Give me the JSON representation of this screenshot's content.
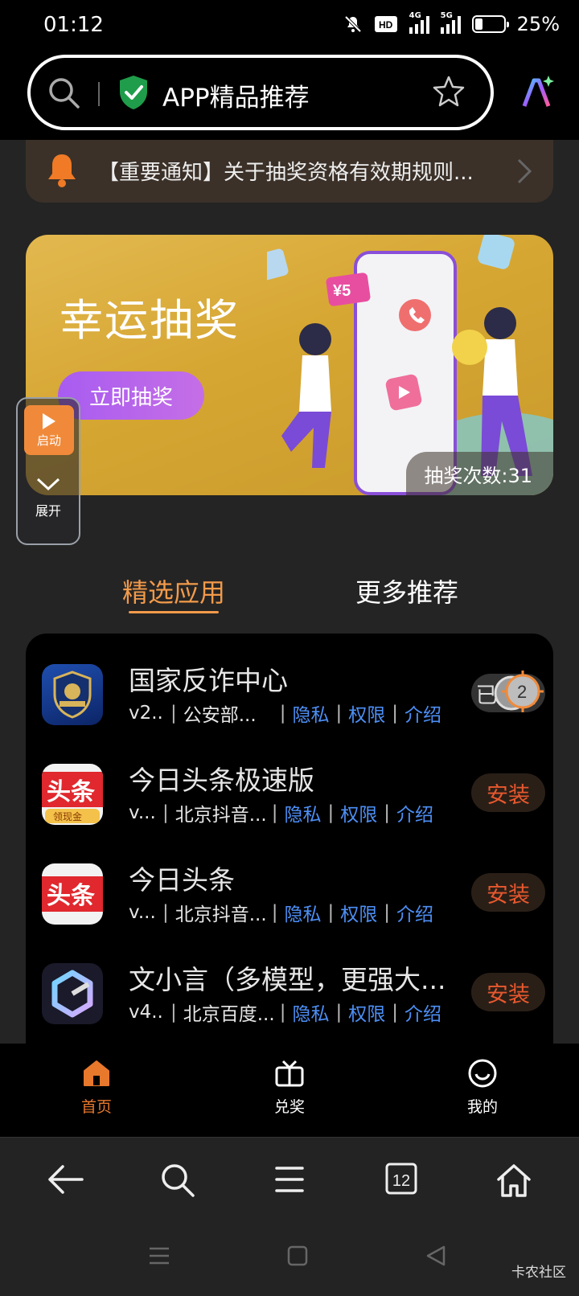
{
  "status_bar": {
    "time": "01:12",
    "battery": "25%",
    "battery_level": 0.25,
    "net_hd": "HD",
    "net_4g": "4G",
    "net_5g": "5G"
  },
  "header": {
    "title": "APP精品推荐"
  },
  "notice": {
    "text": "【重要通知】关于抽奖资格有效期规则..."
  },
  "banner": {
    "title": "幸运抽奖",
    "button": "立即抽奖",
    "draw_count": "抽奖次数:31",
    "price_tag": "¥5"
  },
  "float_panel": {
    "launch": "启动",
    "expand": "展开"
  },
  "tabs": [
    {
      "label": "精选应用",
      "active": true
    },
    {
      "label": "更多推荐",
      "active": false
    }
  ],
  "apps": [
    {
      "name": "国家反诈中心",
      "version": "v2...",
      "developer": "公安部...",
      "privacy": "隐私",
      "permissions": "权限",
      "intro": "介绍",
      "action": "已打开",
      "badge": "2"
    },
    {
      "name": "今日头条极速版",
      "version": "v...",
      "developer": "北京抖音...",
      "privacy": "隐私",
      "permissions": "权限",
      "intro": "介绍",
      "action": "安装",
      "icon_text": "头条",
      "icon_sub": "领现金"
    },
    {
      "name": "今日头条",
      "version": "v...",
      "developer": "北京抖音...",
      "privacy": "隐私",
      "permissions": "权限",
      "intro": "介绍",
      "action": "安装",
      "icon_text": "头条"
    },
    {
      "name": "文小言（多模型，更强大...",
      "version": "v4...",
      "developer": "北京百度...",
      "privacy": "隐私",
      "permissions": "权限",
      "intro": "介绍",
      "action": "安装"
    }
  ],
  "app_nav": [
    {
      "label": "首页",
      "icon": "home-icon"
    },
    {
      "label": "兑奖",
      "icon": "gift-icon"
    },
    {
      "label": "我的",
      "icon": "smile-icon"
    }
  ],
  "browser_bar": {
    "tab_count": "12"
  },
  "watermark": "卡农社区",
  "colors": {
    "accent": "#f29a4a",
    "install": "#e8582e",
    "link": "#4d8ff5",
    "banner": "#d6a632"
  }
}
